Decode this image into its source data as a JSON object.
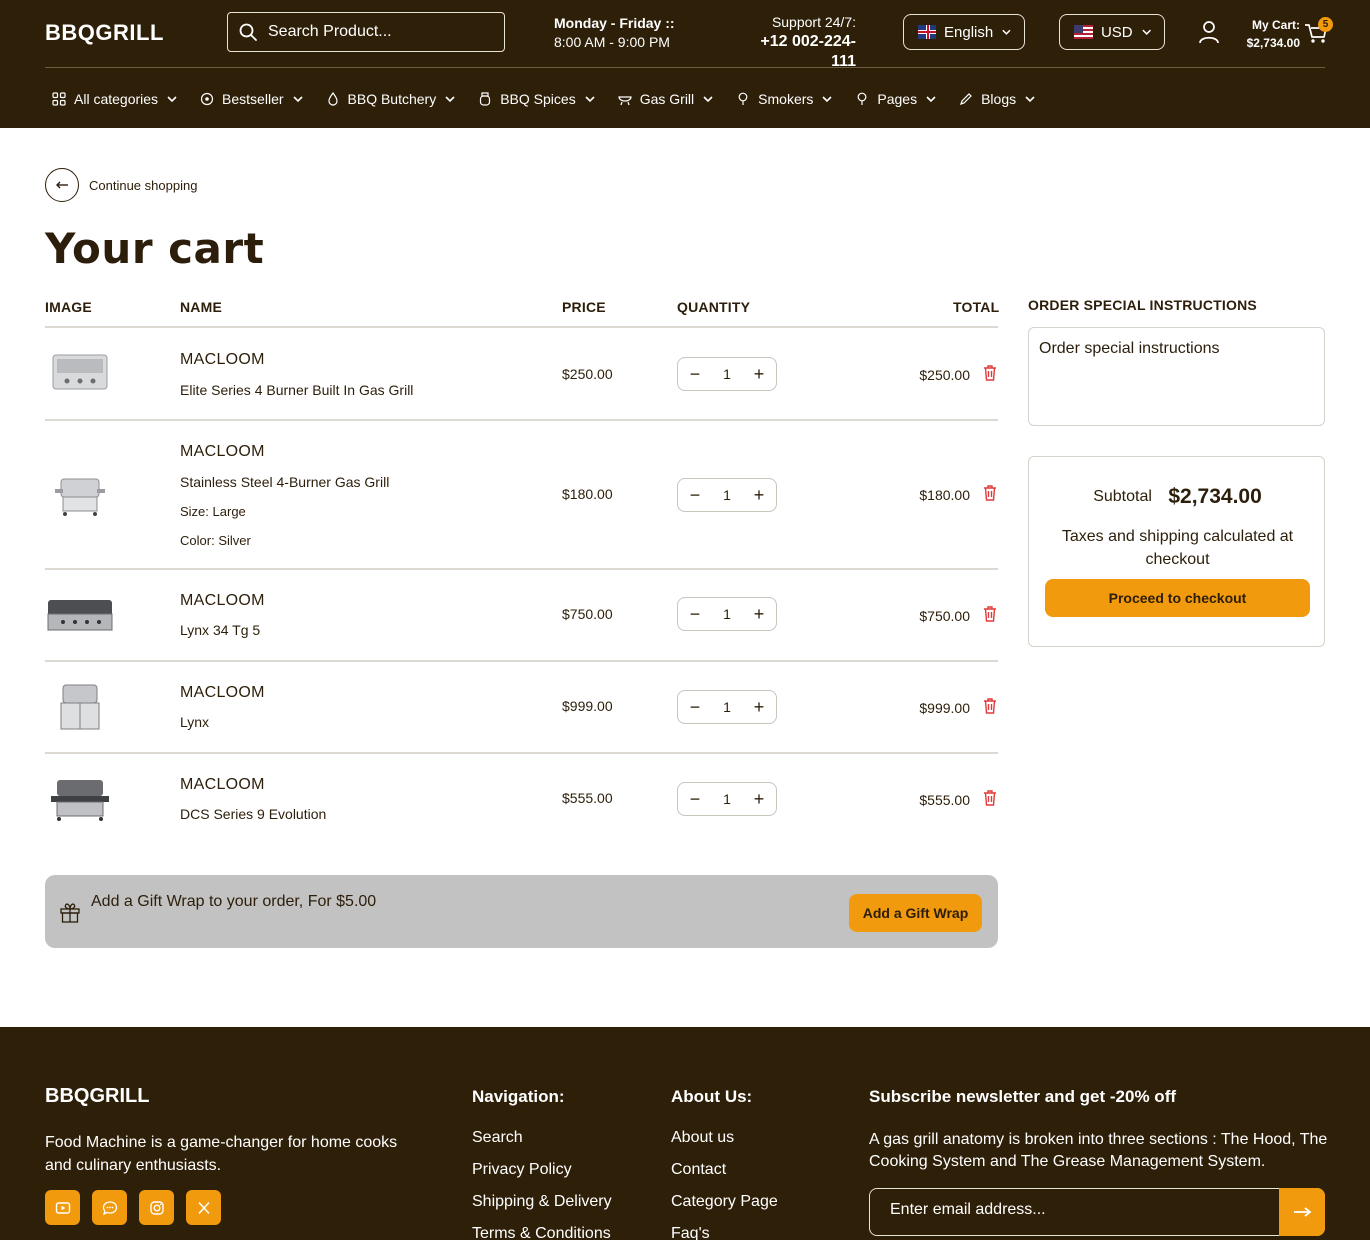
{
  "header": {
    "logo": "BBQGRILL",
    "search_placeholder": "Search Product...",
    "hours_line1": "Monday - Friday ::",
    "hours_line2": "8:00 AM - 9:00 PM",
    "support_label": "Support 24/7:",
    "support_phone": "+12 002-224-111",
    "language": "English",
    "currency": "USD",
    "cart_label": "My Cart:",
    "cart_total": "$2,734.00",
    "cart_count": "5"
  },
  "nav": [
    {
      "label": "All categories",
      "icon": "grid-icon"
    },
    {
      "label": "Bestseller",
      "icon": "badge-icon"
    },
    {
      "label": "BBQ Butchery",
      "icon": "flame-icon"
    },
    {
      "label": "BBQ Spices",
      "icon": "jar-icon"
    },
    {
      "label": "Gas Grill",
      "icon": "grill-icon"
    },
    {
      "label": "Smokers",
      "icon": "bulb-icon"
    },
    {
      "label": "Pages",
      "icon": "bulb-icon"
    },
    {
      "label": "Blogs",
      "icon": "pen-icon"
    }
  ],
  "page": {
    "back_label": "Continue shopping",
    "title": "Your cart"
  },
  "table": {
    "headers": {
      "image": "IMAGE",
      "name": "NAME",
      "price": "PRICE",
      "quantity": "QUANTITY",
      "total": "TOTAL"
    }
  },
  "items": [
    {
      "vendor": "MACLOOM",
      "name": "Elite Series 4 Burner Built In Gas Grill",
      "price": "$250.00",
      "qty": "1",
      "total": "$250.00"
    },
    {
      "vendor": "MACLOOM",
      "name": "Stainless Steel 4-Burner Gas Grill",
      "size_label": "Size:",
      "size": "Large",
      "color_label": "Color:",
      "color": "Silver",
      "price": "$180.00",
      "qty": "1",
      "total": "$180.00"
    },
    {
      "vendor": "MACLOOM",
      "name": "Lynx 34 Tg 5",
      "price": "$750.00",
      "qty": "1",
      "total": "$750.00"
    },
    {
      "vendor": "MACLOOM",
      "name": "Lynx",
      "price": "$999.00",
      "qty": "1",
      "total": "$999.00"
    },
    {
      "vendor": "MACLOOM",
      "name": "DCS Series 9 Evolution",
      "price": "$555.00",
      "qty": "1",
      "total": "$555.00"
    }
  ],
  "gift": {
    "text": "Add a Gift Wrap to your order, For $5.00",
    "button": "Add a Gift Wrap"
  },
  "instructions": {
    "label": "ORDER SPECIAL INSTRUCTIONS",
    "placeholder": "Order special instructions"
  },
  "summary": {
    "subtotal_label": "Subtotal",
    "subtotal": "$2,734.00",
    "tax_note": "Taxes and shipping calculated at checkout",
    "checkout": "Proceed to checkout"
  },
  "footer": {
    "logo": "BBQGRILL",
    "description": "Food Machine is a game-changer for home cooks and culinary enthusiasts.",
    "nav_title": "Navigation:",
    "nav_links": [
      "Search",
      "Privacy Policy",
      "Shipping & Delivery",
      "Terms & Conditions"
    ],
    "about_title": "About Us:",
    "about_links": [
      "About us",
      "Contact",
      "Category Page",
      "Faq's"
    ],
    "newsletter_title": "Subscribe newsletter and get -20% off",
    "newsletter_desc": "A gas grill anatomy is broken into three sections : The Hood, The Cooking System and The Grease Management System.",
    "email_placeholder": "Enter email address..."
  },
  "colors": {
    "brand_dark": "#2e1f09",
    "accent": "#f29a0e",
    "delete_red": "#e03a3a"
  }
}
